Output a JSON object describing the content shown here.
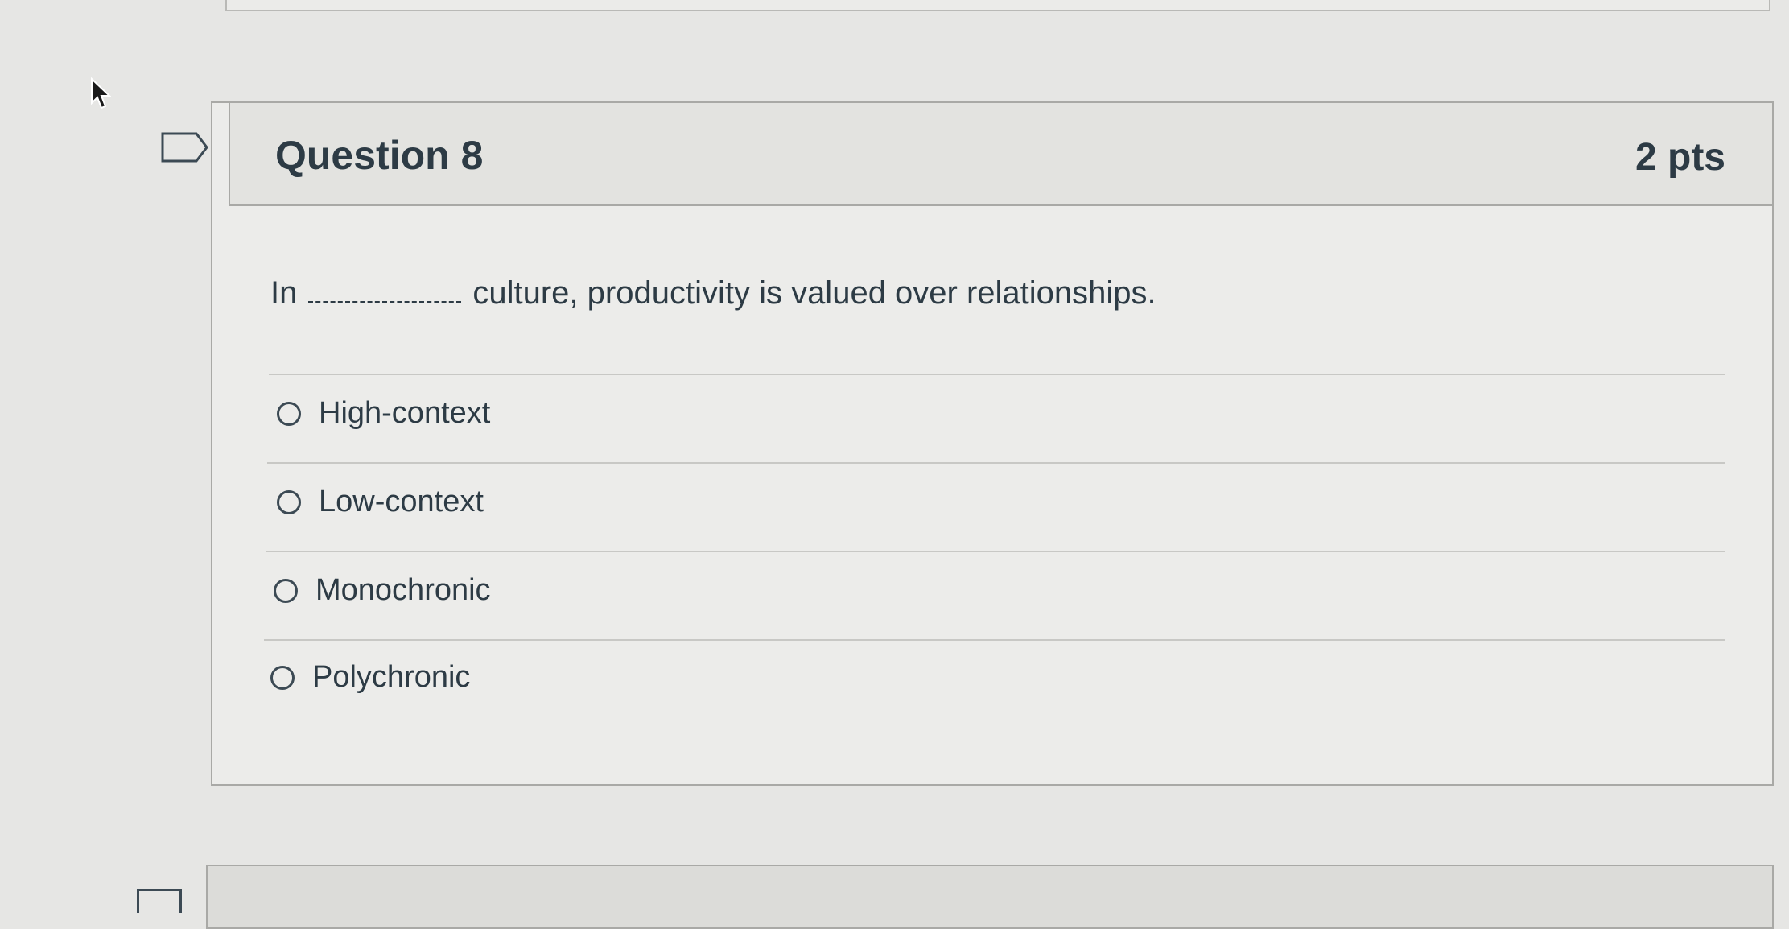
{
  "question": {
    "title": "Question 8",
    "points": "2 pts",
    "text_before": "In",
    "text_after": "culture, productivity is valued over relationships.",
    "flag_icon": "flag-outline-icon"
  },
  "answers": [
    {
      "label": "High-context",
      "selected": false
    },
    {
      "label": "Low-context",
      "selected": false
    },
    {
      "label": "Monochronic",
      "selected": false
    },
    {
      "label": "Polychronic",
      "selected": false
    }
  ],
  "cursor_icon": "mouse-pointer-icon"
}
